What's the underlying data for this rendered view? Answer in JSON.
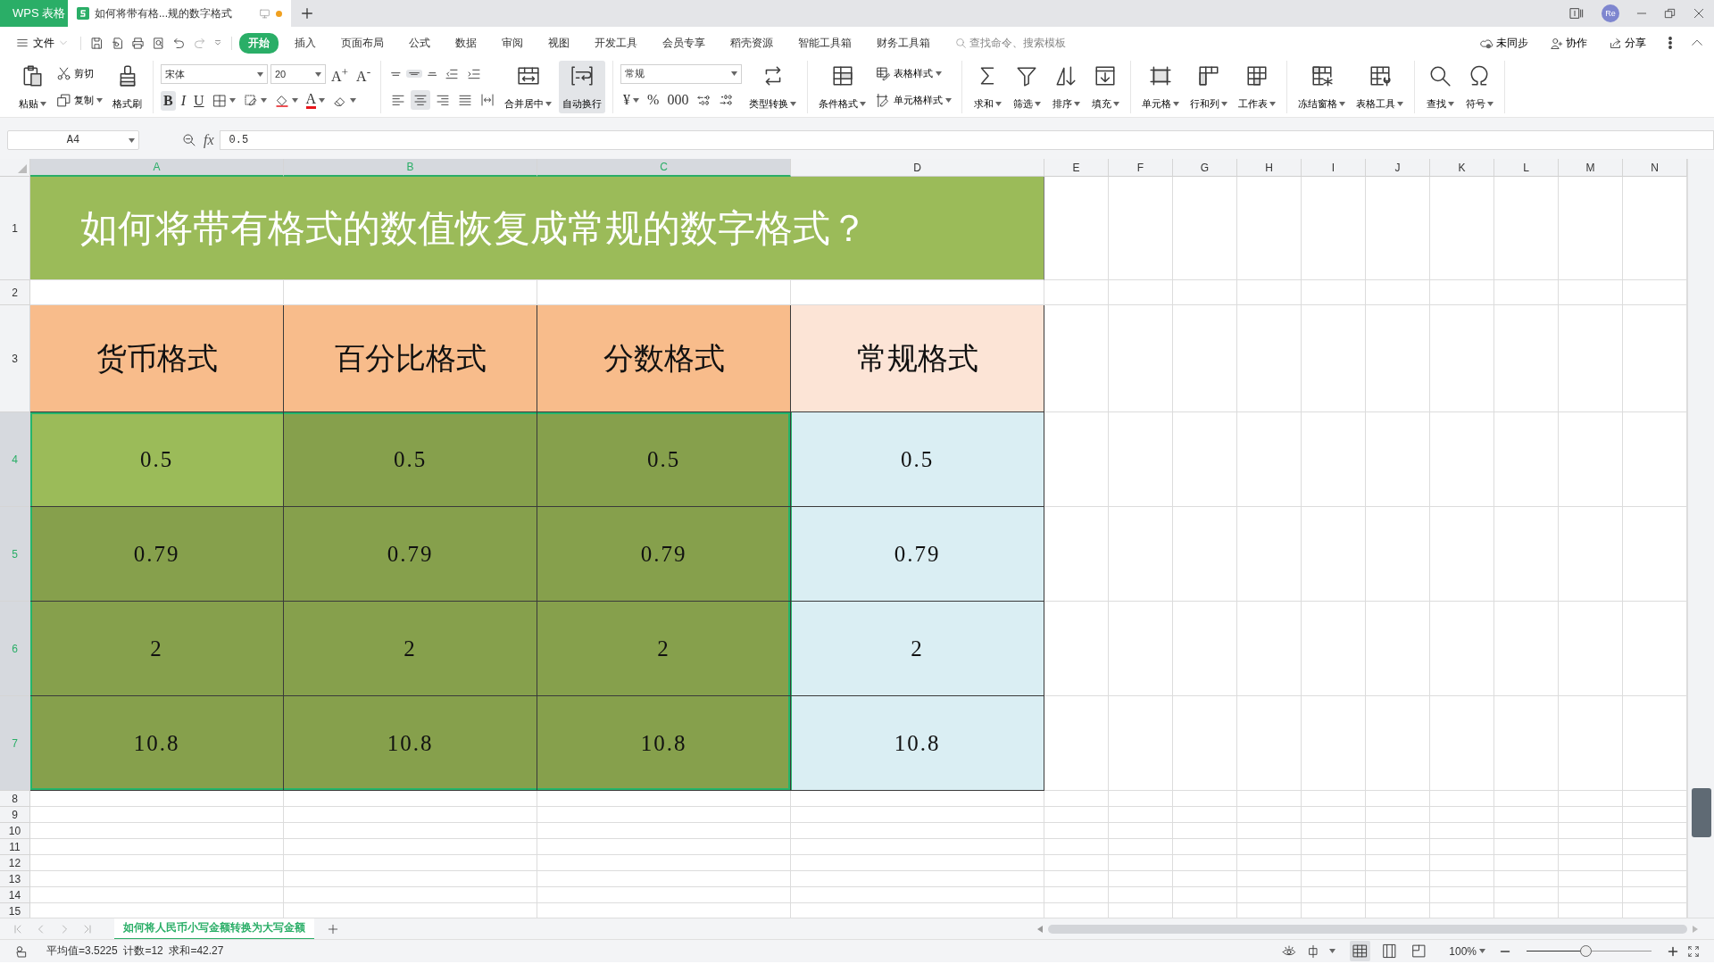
{
  "title_bar": {
    "app_tab": "WPS 表格",
    "document_tab": {
      "title": "如何将带有格...规的数字格式",
      "selected": true,
      "unsaved": true
    },
    "account_initials": "Re"
  },
  "menu": {
    "file": "文件",
    "tabs": [
      {
        "label": "开始",
        "selected": true
      },
      {
        "label": "插入",
        "selected": false
      },
      {
        "label": "页面布局",
        "selected": false
      },
      {
        "label": "公式",
        "selected": false
      },
      {
        "label": "数据",
        "selected": false
      },
      {
        "label": "审阅",
        "selected": false
      },
      {
        "label": "视图",
        "selected": false
      },
      {
        "label": "开发工具",
        "selected": false
      },
      {
        "label": "会员专享",
        "selected": false
      },
      {
        "label": "稻壳资源",
        "selected": false
      },
      {
        "label": "智能工具箱",
        "selected": false
      },
      {
        "label": "财务工具箱",
        "selected": false
      }
    ],
    "search": {
      "placeholder": "查找命令、搜索模板"
    },
    "actions": [
      "未同步",
      "协作",
      "分享"
    ]
  },
  "ribbon": {
    "groups": [
      {
        "columns": [
          {
            "kind": "big",
            "label": "粘贴",
            "dropdown": true,
            "selected": false
          },
          {
            "kind": "stack",
            "top": [
              {
                "kind": "small",
                "label": "剪切",
                "dropdown": false,
                "selected": false
              }
            ],
            "bottom": [
              {
                "kind": "small",
                "label": "复制",
                "dropdown": true,
                "selected": false
              }
            ]
          },
          {
            "kind": "big",
            "label": "格式刷",
            "dropdown": false,
            "selected": false
          }
        ]
      },
      {
        "columns": [
          {
            "kind": "stack",
            "top": [
              {
                "kind": "field",
                "value": "宋体",
                "wide": false
              },
              {
                "kind": "field",
                "value": "20",
                "wide": false
              },
              {
                "kind": "char",
                "text": "A$^{+}$",
                "dropdown": false,
                "selected": false
              },
              {
                "kind": "char",
                "text": "A$^{-}$",
                "dropdown": false,
                "selected": false
              }
            ],
            "bottom": [
              {
                "kind": "bold",
                "text": "B",
                "dropdown": false,
                "selected": true
              },
              {
                "kind": "italic",
                "text": "I",
                "dropdown": false,
                "selected": false
              },
              {
                "kind": "underline",
                "text": "U",
                "dropdown": false,
                "selected": false
              },
              {
                "kind": "icon",
                "dropdown": true,
                "selected": false
              },
              {
                "kind": "icon",
                "dropdown": true,
                "selected": false
              },
              {
                "kind": "icon",
                "dropdown": true,
                "selected": false
              },
              {
                "kind": "char",
                "text": "A",
                "color": "#e8161b",
                "dropdown": true,
                "selected": false
              },
              {
                "kind": "icon",
                "dropdown": true,
                "selected": false
              }
            ]
          }
        ]
      },
      {
        "columns": [
          {
            "kind": "stack",
            "top": [
              {
                "kind": "icon",
                "dropdown": false,
                "selected": false
              },
              {
                "kind": "icon",
                "dropdown": false,
                "selected": true
              },
              {
                "kind": "icon",
                "dropdown": false,
                "selected": false
              },
              {
                "kind": "icon",
                "dropdown": false,
                "selected": false
              },
              {
                "kind": "icon",
                "dropdown": false,
                "selected": false
              }
            ],
            "bottom": [
              {
                "kind": "icon",
                "dropdown": false,
                "selected": false
              },
              {
                "kind": "icon",
                "dropdown": false,
                "selected": true
              },
              {
                "kind": "icon",
                "dropdown": false,
                "selected": false
              },
              {
                "kind": "icon",
                "dropdown": false,
                "selected": false
              },
              {
                "kind": "icon",
                "dropdown": false,
                "selected": false
              }
            ]
          },
          {
            "kind": "big",
            "label": "合并居中",
            "dropdown": true,
            "selected": false
          },
          {
            "kind": "big",
            "label": "自动换行",
            "dropdown": false,
            "selected": true
          }
        ]
      },
      {
        "columns": [
          {
            "kind": "stack",
            "top": [
              {
                "kind": "field",
                "value": "常规",
                "wide": true
              }
            ],
            "bottom": [
              {
                "kind": "char",
                "text": "¥",
                "dropdown": true,
                "selected": false
              },
              {
                "kind": "char",
                "text": "%",
                "dropdown": false,
                "selected": false
              },
              {
                "kind": "char",
                "text": "000",
                "dropdown": false,
                "selected": false
              },
              {
                "kind": "icon",
                "dropdown": false,
                "selected": false
              },
              {
                "kind": "icon",
                "dropdown": false,
                "selected": false
              }
            ]
          },
          {
            "kind": "big",
            "label": "类型转换",
            "dropdown": true,
            "selected": false
          }
        ]
      },
      {
        "columns": [
          {
            "kind": "big",
            "label": "条件格式",
            "dropdown": true,
            "selected": false
          },
          {
            "kind": "stack",
            "top": [
              {
                "kind": "small",
                "label": "表格样式",
                "dropdown": true,
                "selected": false
              }
            ],
            "bottom": [
              {
                "kind": "small",
                "label": "单元格样式",
                "dropdown": true,
                "selected": false
              }
            ]
          }
        ]
      },
      {
        "columns": [
          {
            "kind": "big",
            "label": "求和",
            "dropdown": true,
            "selected": false
          },
          {
            "kind": "big",
            "label": "筛选",
            "dropdown": true,
            "selected": false
          },
          {
            "kind": "big",
            "label": "排序",
            "dropdown": true,
            "selected": false
          },
          {
            "kind": "big",
            "label": "填充",
            "dropdown": true,
            "selected": false
          }
        ]
      },
      {
        "columns": [
          {
            "kind": "big",
            "label": "单元格",
            "dropdown": true,
            "selected": false
          },
          {
            "kind": "big",
            "label": "行和列",
            "dropdown": true,
            "selected": false
          },
          {
            "kind": "big",
            "label": "工作表",
            "dropdown": true,
            "selected": false
          }
        ]
      },
      {
        "columns": [
          {
            "kind": "big",
            "label": "冻结窗格",
            "dropdown": true,
            "selected": false
          },
          {
            "kind": "big",
            "label": "表格工具",
            "dropdown": true,
            "selected": false
          }
        ]
      },
      {
        "columns": [
          {
            "kind": "big",
            "label": "查找",
            "dropdown": true,
            "selected": false
          },
          {
            "kind": "big",
            "label": "符号",
            "dropdown": true,
            "selected": false
          }
        ]
      }
    ]
  },
  "formula_bar": {
    "cell_ref": "A4",
    "fx_label": "fx",
    "value": "0.5"
  },
  "columns": [
    {
      "label": "A",
      "selected": true
    },
    {
      "label": "B",
      "selected": true
    },
    {
      "label": "C",
      "selected": true
    },
    {
      "label": "D",
      "selected": false
    },
    {
      "label": "E",
      "selected": false
    },
    {
      "label": "F",
      "selected": false
    },
    {
      "label": "G",
      "selected": false
    },
    {
      "label": "H",
      "selected": false
    },
    {
      "label": "I",
      "selected": false
    },
    {
      "label": "J",
      "selected": false
    },
    {
      "label": "K",
      "selected": false
    },
    {
      "label": "L",
      "selected": false
    },
    {
      "label": "M",
      "selected": false
    },
    {
      "label": "N",
      "selected": false
    }
  ],
  "rows": [
    {
      "number": "1",
      "kind": "title",
      "selected": false,
      "cells": [
        {
          "text": "如何将带有格式的数值恢复成常规的数字格式？",
          "color": "#9bbb59"
        }
      ]
    },
    {
      "number": "2",
      "kind": "blank",
      "selected": false,
      "cells": []
    },
    {
      "number": "3",
      "kind": "header",
      "selected": false,
      "cells": [
        {
          "text": "货币格式",
          "color": "#f8bc8b"
        },
        {
          "text": "百分比格式",
          "color": "#f8bc8b"
        },
        {
          "text": "分数格式",
          "color": "#f8bc8b"
        },
        {
          "text": "常规格式",
          "color": "#fce4d6"
        }
      ]
    },
    {
      "number": "4",
      "kind": "data",
      "selected": true,
      "cells": [
        {
          "text": "0.5",
          "color": "#9bbb59"
        },
        {
          "text": "0.5",
          "color": "#86a04c"
        },
        {
          "text": "0.5",
          "color": "#86a04c"
        },
        {
          "text": "0.5",
          "color": "#daeef3"
        }
      ]
    },
    {
      "number": "5",
      "kind": "data",
      "selected": true,
      "cells": [
        {
          "text": "0.79",
          "color": "#86a04c"
        },
        {
          "text": "0.79",
          "color": "#86a04c"
        },
        {
          "text": "0.79",
          "color": "#86a04c"
        },
        {
          "text": "0.79",
          "color": "#daeef3"
        }
      ]
    },
    {
      "number": "6",
      "kind": "data",
      "selected": true,
      "cells": [
        {
          "text": "2",
          "color": "#86a04c"
        },
        {
          "text": "2",
          "color": "#86a04c"
        },
        {
          "text": "2",
          "color": "#86a04c"
        },
        {
          "text": "2",
          "color": "#daeef3"
        }
      ]
    },
    {
      "number": "7",
      "kind": "data",
      "selected": true,
      "cells": [
        {
          "text": "10.8",
          "color": "#86a04c"
        },
        {
          "text": "10.8",
          "color": "#86a04c"
        },
        {
          "text": "10.8",
          "color": "#86a04c"
        },
        {
          "text": "10.8",
          "color": "#daeef3"
        }
      ]
    },
    {
      "number": "8",
      "kind": "blank",
      "selected": false,
      "cells": []
    },
    {
      "number": "9",
      "kind": "blank",
      "selected": false,
      "cells": []
    },
    {
      "number": "10",
      "kind": "blank",
      "selected": false,
      "cells": []
    },
    {
      "number": "11",
      "kind": "blank",
      "selected": false,
      "cells": []
    },
    {
      "number": "12",
      "kind": "blank",
      "selected": false,
      "cells": []
    },
    {
      "number": "13",
      "kind": "blank",
      "selected": false,
      "cells": []
    },
    {
      "number": "14",
      "kind": "blank",
      "selected": false,
      "cells": []
    },
    {
      "number": "15",
      "kind": "blank",
      "selected": false,
      "cells": []
    }
  ],
  "sheet_tabs": [
    {
      "label": "如何将人民币小写金额转换为大写金额",
      "selected": true
    }
  ],
  "status_bar": {
    "summary": "平均值=3.5225  计数=12  求和=42.27",
    "zoom": "100%",
    "zoom_slider": {
      "level": 0.48
    }
  }
}
